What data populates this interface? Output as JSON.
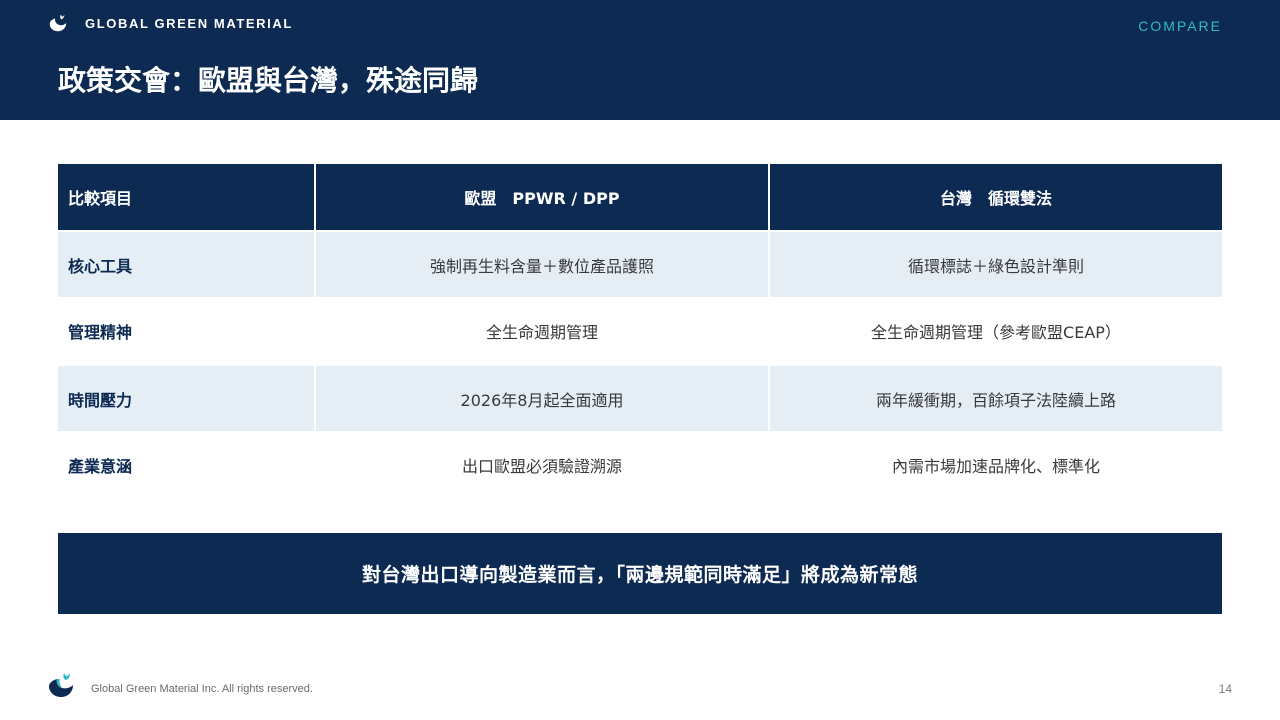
{
  "header": {
    "brand_name": "GLOBAL GREEN MATERIAL",
    "section_tag": "COMPARE",
    "title": "政策交會：歐盟與台灣，殊途同歸"
  },
  "table": {
    "columns": [
      "比較項目",
      "歐盟　PPWR / DPP",
      "台灣　循環雙法"
    ],
    "rows": [
      [
        "核心工具",
        "強制再生料含量＋數位產品護照",
        "循環標誌＋綠色設計準則"
      ],
      [
        "管理精神",
        "全生命週期管理",
        "全生命週期管理（參考歐盟CEAP）"
      ],
      [
        "時間壓力",
        "2026年8月起全面適用",
        "兩年緩衝期，百餘項子法陸續上路"
      ],
      [
        "產業意涵",
        "出口歐盟必須驗證溯源",
        "內需市場加速品牌化、標準化"
      ]
    ]
  },
  "banner": {
    "text": "對台灣出口導向製造業而言，「兩邊規範同時滿足」將成為新常態"
  },
  "footer": {
    "copyright": "Global Green Material Inc. All rights reserved.",
    "page_number": "14"
  },
  "colors": {
    "navy": "#0d2a52",
    "teal": "#2fb9c9",
    "row_shade": "#e5edf5"
  },
  "icons": {
    "brand_logo": "whale-logo-icon",
    "footer_logo": "whale-logo-icon"
  }
}
